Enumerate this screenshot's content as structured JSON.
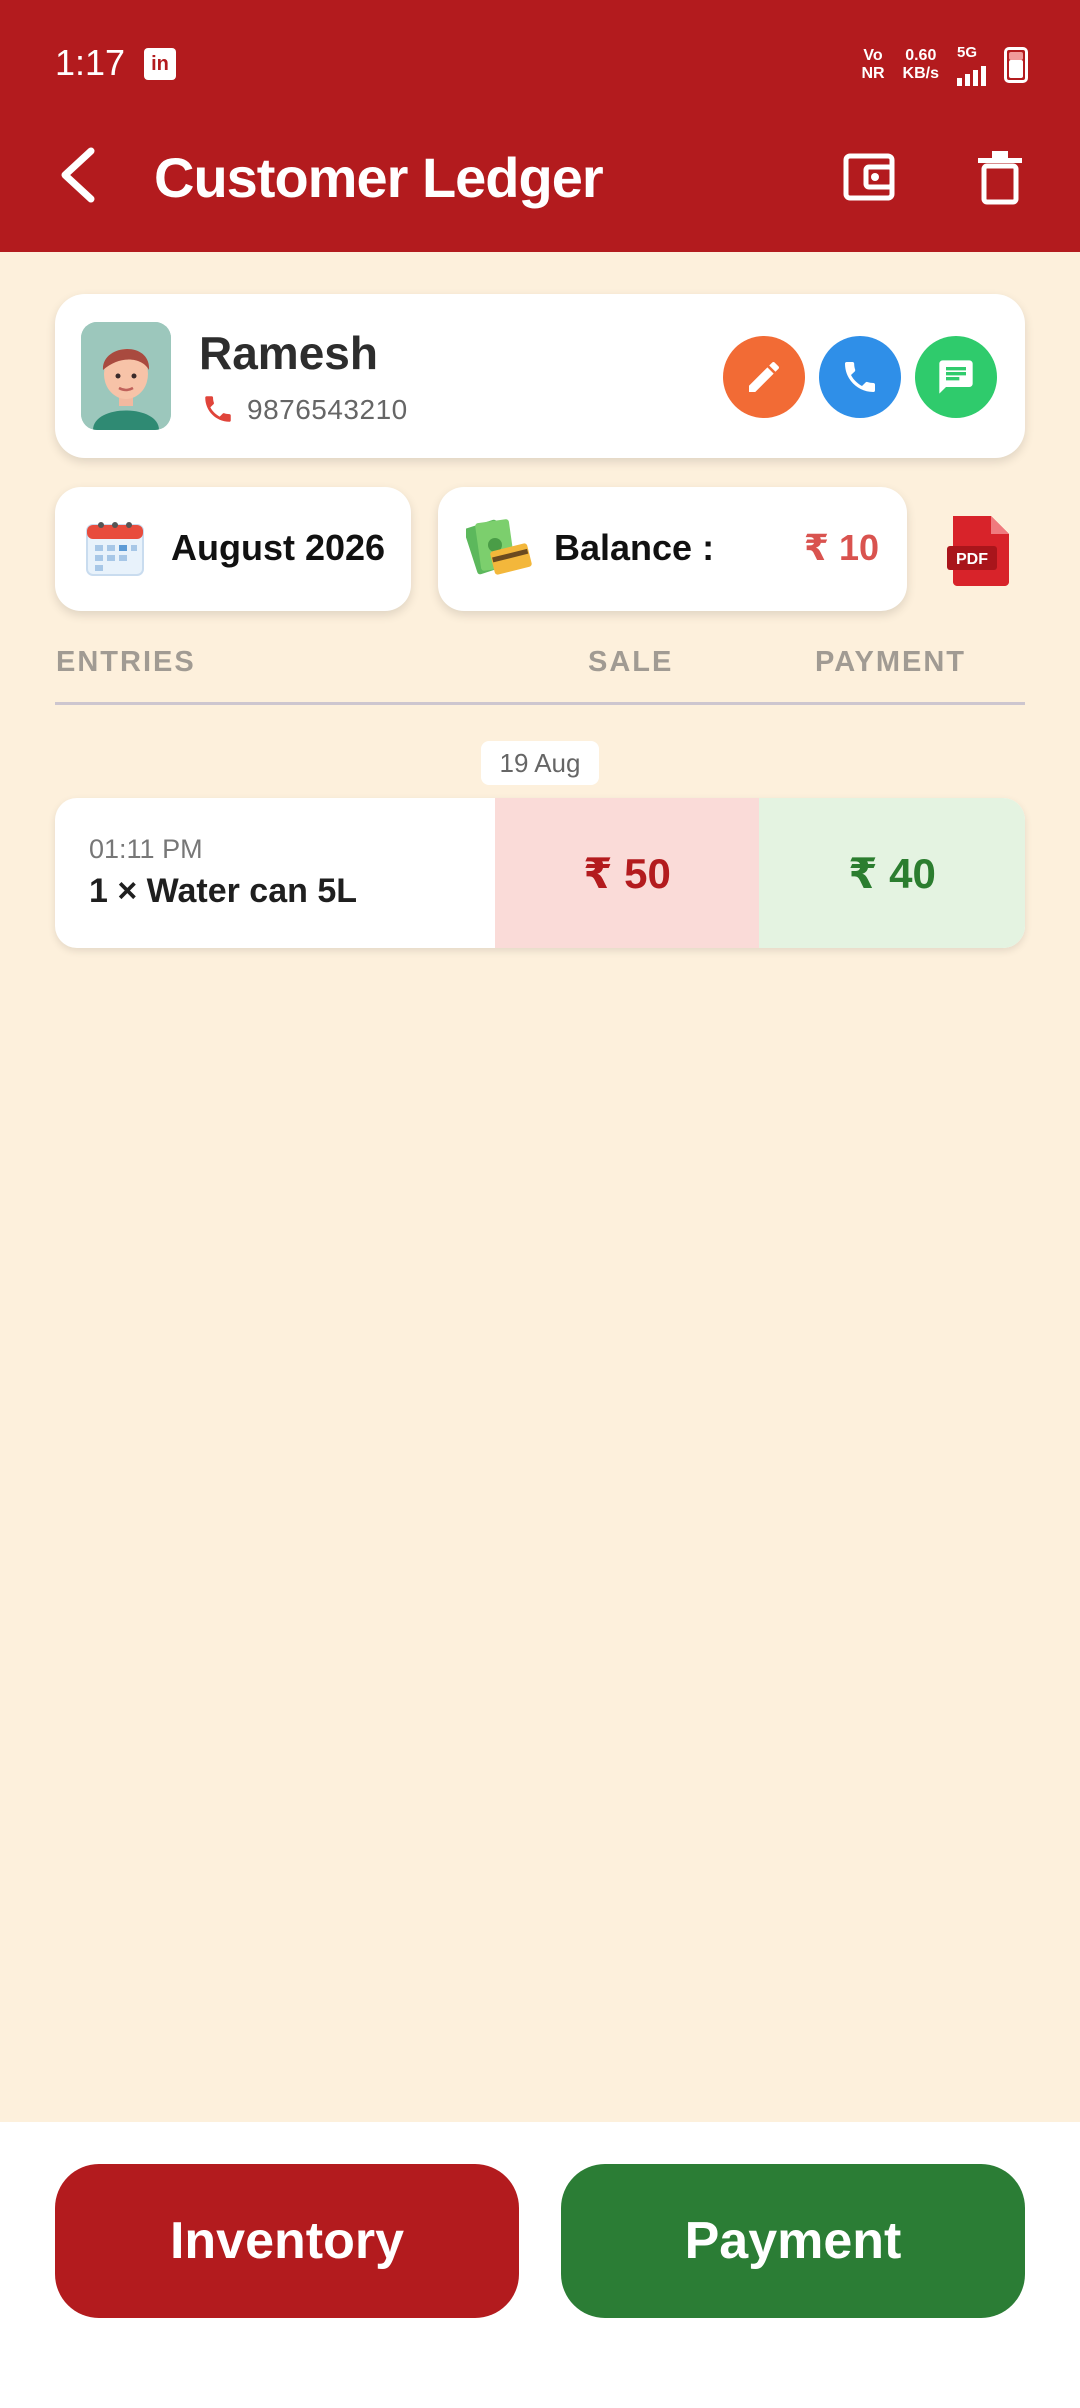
{
  "status_bar": {
    "time": "1:17",
    "app_icon": "in",
    "network_vo": "Vo",
    "network_nr": "NR",
    "speed_value": "0.60",
    "speed_unit": "KB/s",
    "network_type": "5G"
  },
  "header": {
    "title": "Customer Ledger",
    "back_icon": "chevron-left",
    "wallet_icon": "wallet",
    "delete_icon": "trash"
  },
  "customer": {
    "name": "Ramesh",
    "phone": "9876543210",
    "actions": {
      "edit_icon": "pencil",
      "call_icon": "phone",
      "message_icon": "chat"
    }
  },
  "summary": {
    "month": "August 2026",
    "balance_label": "Balance :",
    "balance_value": "₹ 10",
    "pdf_label": "PDF"
  },
  "columns": {
    "entries": "ENTRIES",
    "sale": "SALE",
    "payment": "PAYMENT"
  },
  "groups": [
    {
      "date": "19 Aug",
      "entries": [
        {
          "time": "01:11 PM",
          "item": "1 × Water can 5L",
          "sale": "₹ 50",
          "payment": "₹ 40"
        }
      ]
    }
  ],
  "actions": {
    "inventory": "Inventory",
    "payment": "Payment"
  },
  "colors": {
    "primary": "#b31b1e",
    "background": "#fdf0dc",
    "sale_bg": "#fadbd8",
    "payment_bg": "#e4f3e1",
    "payment_button": "#2b7d35"
  }
}
